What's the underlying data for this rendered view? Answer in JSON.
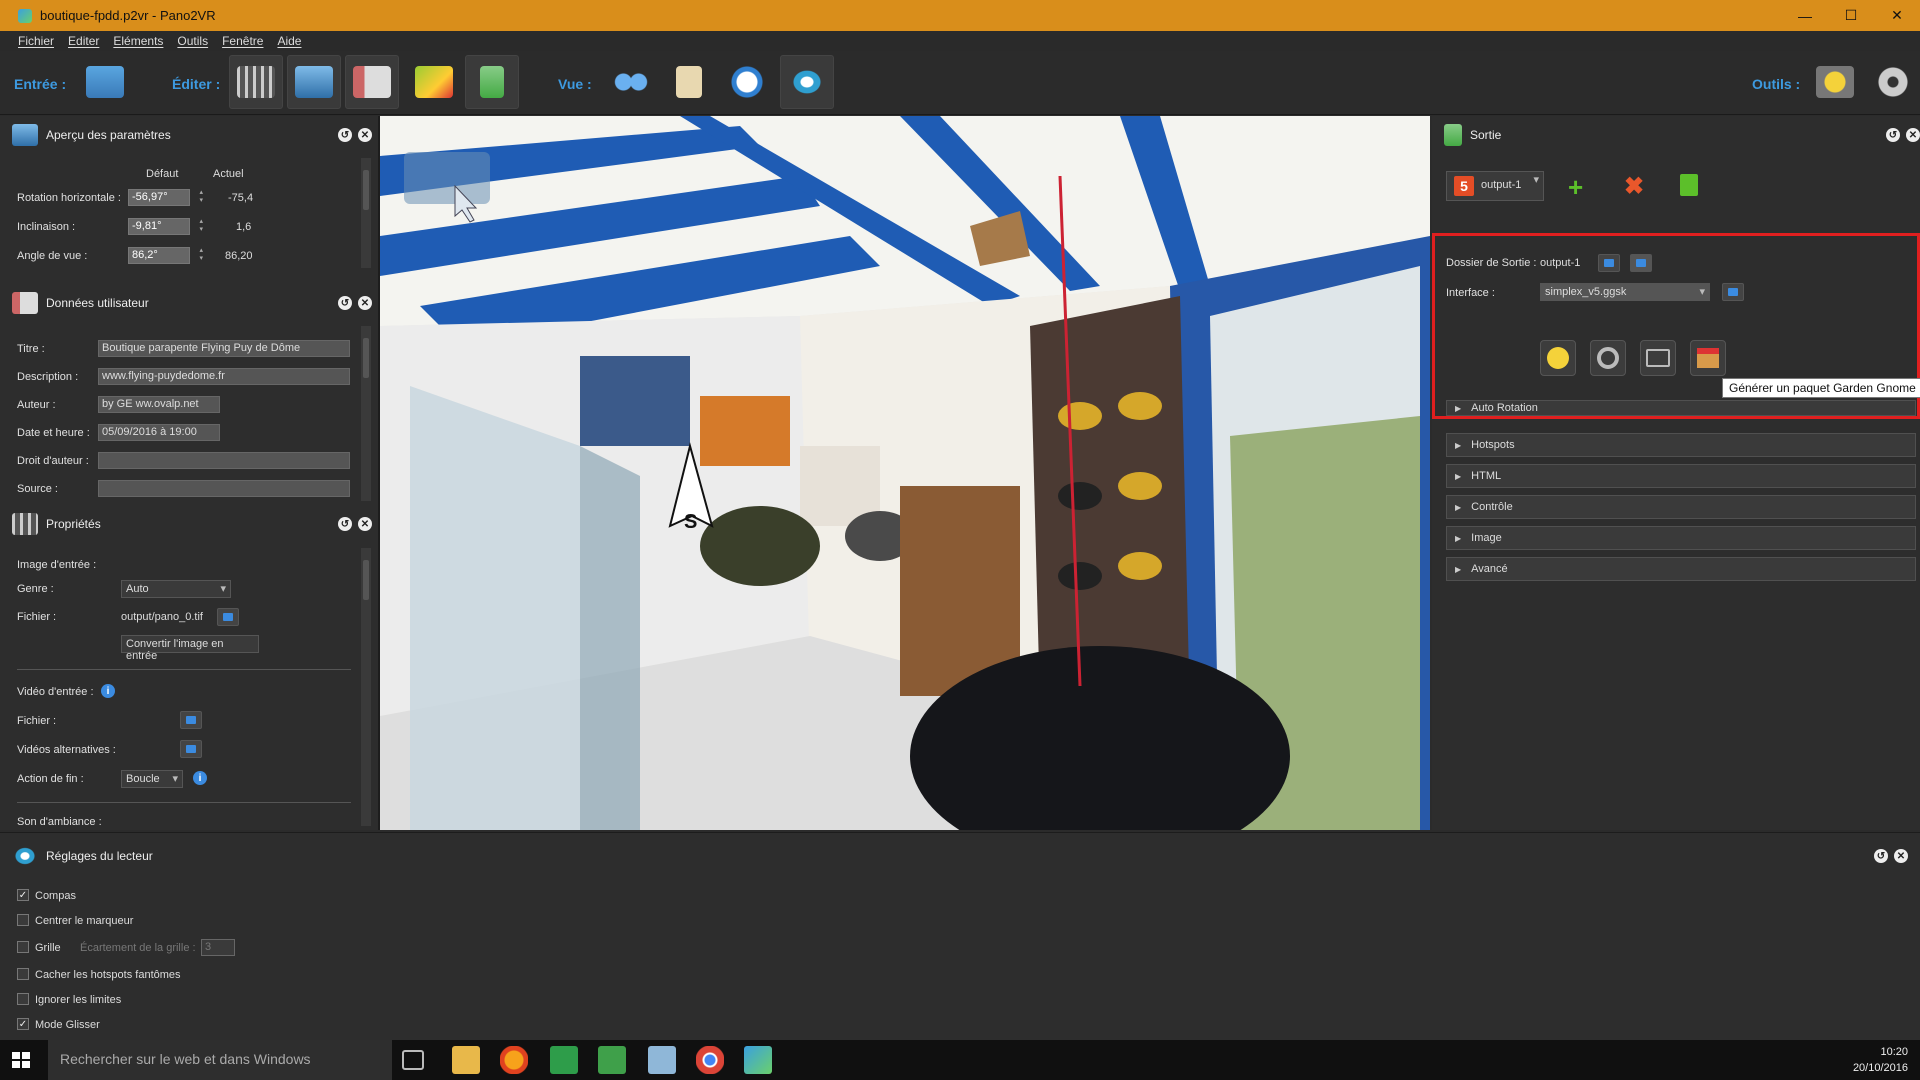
{
  "window": {
    "title": "boutique-fpdd.p2vr - Pano2VR",
    "controls": [
      "—",
      "☐",
      "✕"
    ]
  },
  "menu": [
    "Fichier",
    "Editer",
    "Eléments",
    "Outils",
    "Fenêtre",
    "Aide"
  ],
  "toolbar": {
    "entree_label": "Entrée :",
    "editer_label": "Éditer :",
    "vue_label": "Vue :",
    "outils_label": "Outils :"
  },
  "apercu": {
    "title": "Aperçu des paramètres",
    "col_default": "Défaut",
    "col_current": "Actuel",
    "rows": [
      {
        "label": "Rotation horizontale :",
        "default": "-56,97°",
        "current": "-75,4"
      },
      {
        "label": "Inclinaison :",
        "default": "-9,81°",
        "current": "1,6"
      },
      {
        "label": "Angle de vue :",
        "default": "86,2°",
        "current": "86,20"
      }
    ]
  },
  "donnees": {
    "title": "Données utilisateur",
    "rows": [
      {
        "label": "Titre :",
        "value": "Boutique parapente Flying Puy de Dôme"
      },
      {
        "label": "Description :",
        "value": "www.flying-puydedome.fr"
      },
      {
        "label": "Auteur :",
        "value": "by GE ww.ovalp.net"
      },
      {
        "label": "Date et heure :",
        "value": "05/09/2016 à 19:00"
      },
      {
        "label": "Droit d'auteur :",
        "value": ""
      },
      {
        "label": "Source :",
        "value": ""
      }
    ]
  },
  "proprietes": {
    "title": "Propriétés",
    "image_entree": "Image d'entrée :",
    "genre_label": "Genre :",
    "genre_value": "Auto",
    "fichier_label": "Fichier :",
    "fichier_value": "output/pano_0.tif",
    "convertir": "Convertir l'image en entrée",
    "video_entree": "Vidéo d'entrée :",
    "video_fichier": "Fichier :",
    "videos_alt": "Vidéos alternatives :",
    "action_fin_label": "Action de fin :",
    "action_fin_value": "Boucle",
    "son": "Son d'ambiance :"
  },
  "sortie": {
    "title": "Sortie",
    "output_select": "output-1",
    "dossier_label": "Dossier de Sortie :",
    "dossier_value": "output-1",
    "interface_label": "Interface :",
    "interface_value": "simplex_v5.ggsk",
    "tooltip": "Générer un paquet Garden Gnome",
    "sections": [
      "Auto Rotation",
      "Hotspots",
      "HTML",
      "Contrôle",
      "Image",
      "Avancé"
    ]
  },
  "lecteur": {
    "title": "Réglages du lecteur",
    "options": [
      {
        "label": "Compas",
        "checked": true
      },
      {
        "label": "Centrer le marqueur",
        "checked": false
      },
      {
        "label": "Grille",
        "checked": false
      },
      {
        "label": "Cacher les hotspots fantômes",
        "checked": false
      },
      {
        "label": "Ignorer les limites",
        "checked": false
      },
      {
        "label": "Mode Glisser",
        "checked": true
      }
    ],
    "grid_spacing_label": "Écartement de la grille :",
    "grid_spacing_value": "3"
  },
  "taskbar": {
    "search_placeholder": "Rechercher sur le web et dans Windows",
    "time": "10:20",
    "date": "20/10/2016"
  },
  "colors": {
    "accent": "#d98e1b",
    "highlight_box": "#e01f1f",
    "label_blue": "#3d9ae0"
  }
}
